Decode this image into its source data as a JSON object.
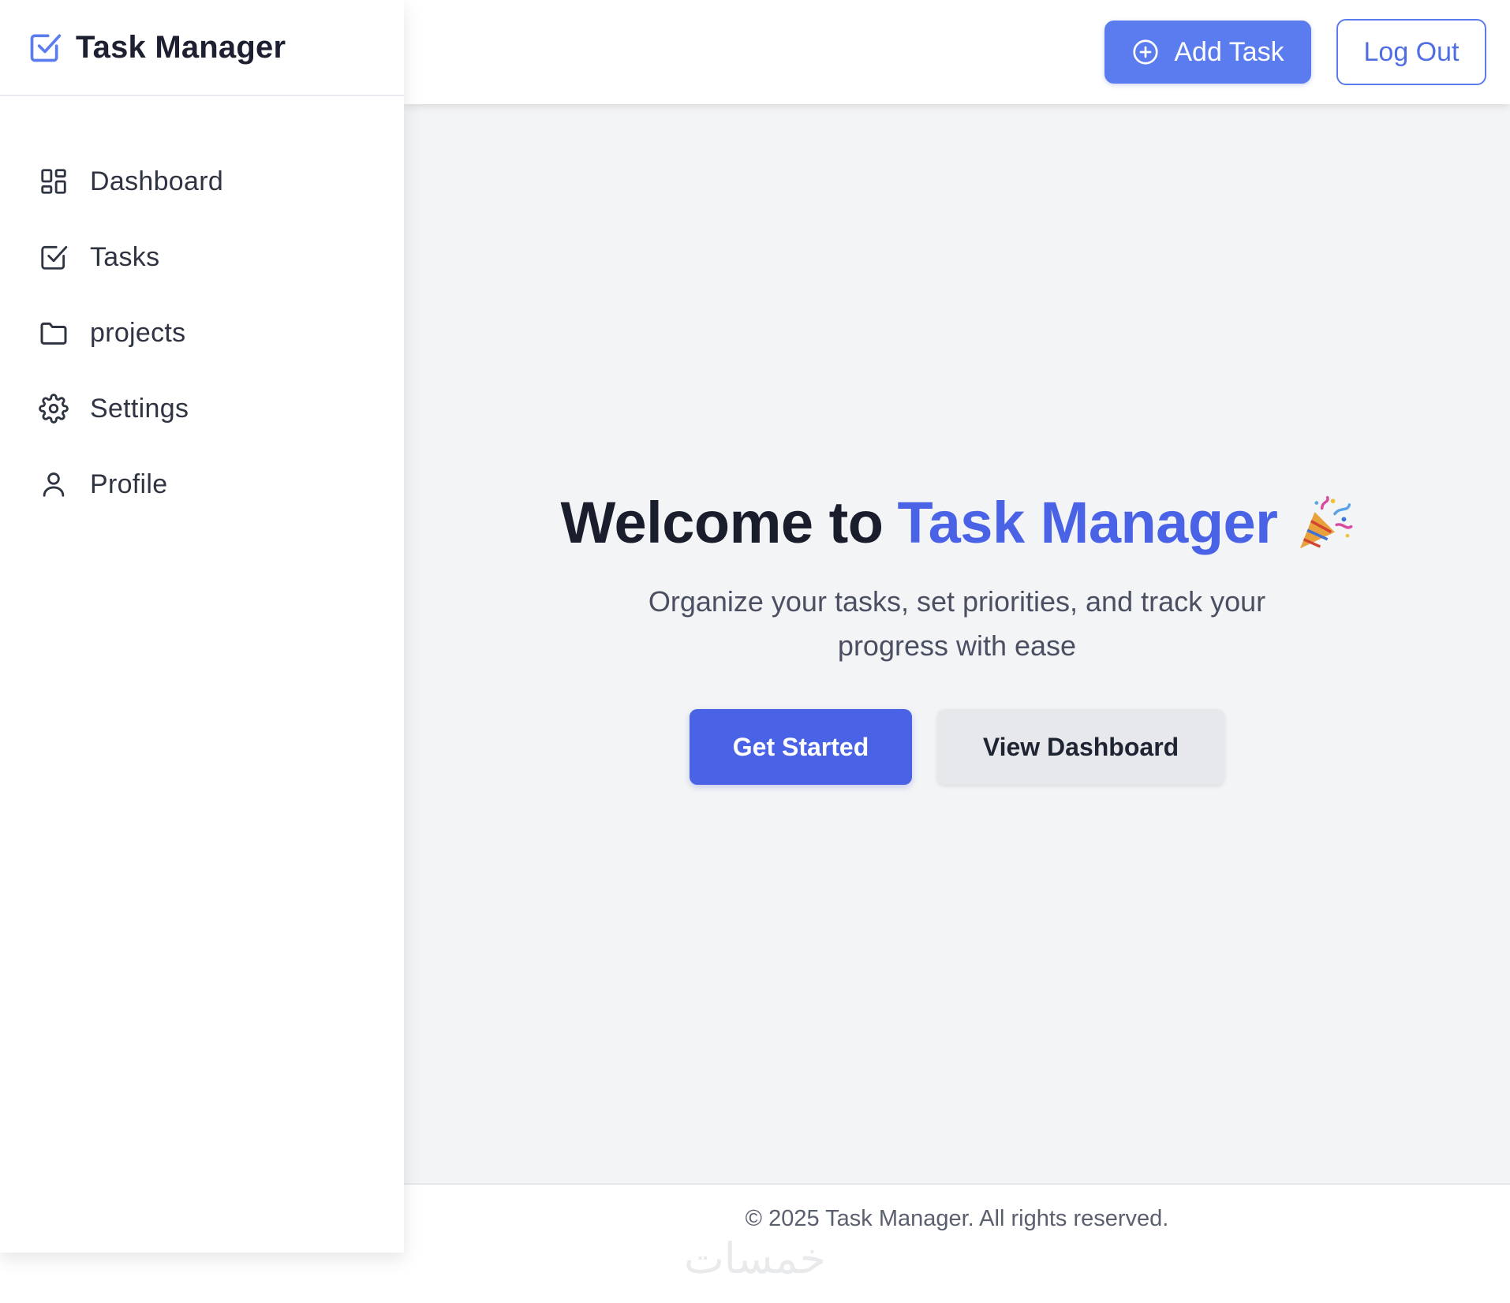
{
  "brand": {
    "title": "Task Manager",
    "icon": "checkbox-icon"
  },
  "sidebar": {
    "items": [
      {
        "label": "Dashboard",
        "icon": "dashboard-grid-icon"
      },
      {
        "label": "Tasks",
        "icon": "checkbox-icon"
      },
      {
        "label": "projects",
        "icon": "folder-icon"
      },
      {
        "label": "Settings",
        "icon": "gear-icon"
      },
      {
        "label": "Profile",
        "icon": "user-icon"
      }
    ]
  },
  "topbar": {
    "add_task_label": "Add Task",
    "add_task_icon": "plus-circle-icon",
    "logout_label": "Log Out"
  },
  "hero": {
    "title_prefix": "Welcome to",
    "title_accent": "Task Manager",
    "emoji_icon": "party-popper-icon",
    "subtitle": "Organize your tasks, set priorities, and track your progress with ease",
    "primary_button": "Get Started",
    "secondary_button": "View Dashboard"
  },
  "footer": {
    "text": "© 2025 Task Manager. All rights reserved."
  },
  "watermark": {
    "text": "خمسات"
  },
  "colors": {
    "accent": "#4a63e6",
    "accent_light": "#5b7cee",
    "main_bg": "#f3f4f6",
    "text_dark": "#1a1e2c"
  }
}
